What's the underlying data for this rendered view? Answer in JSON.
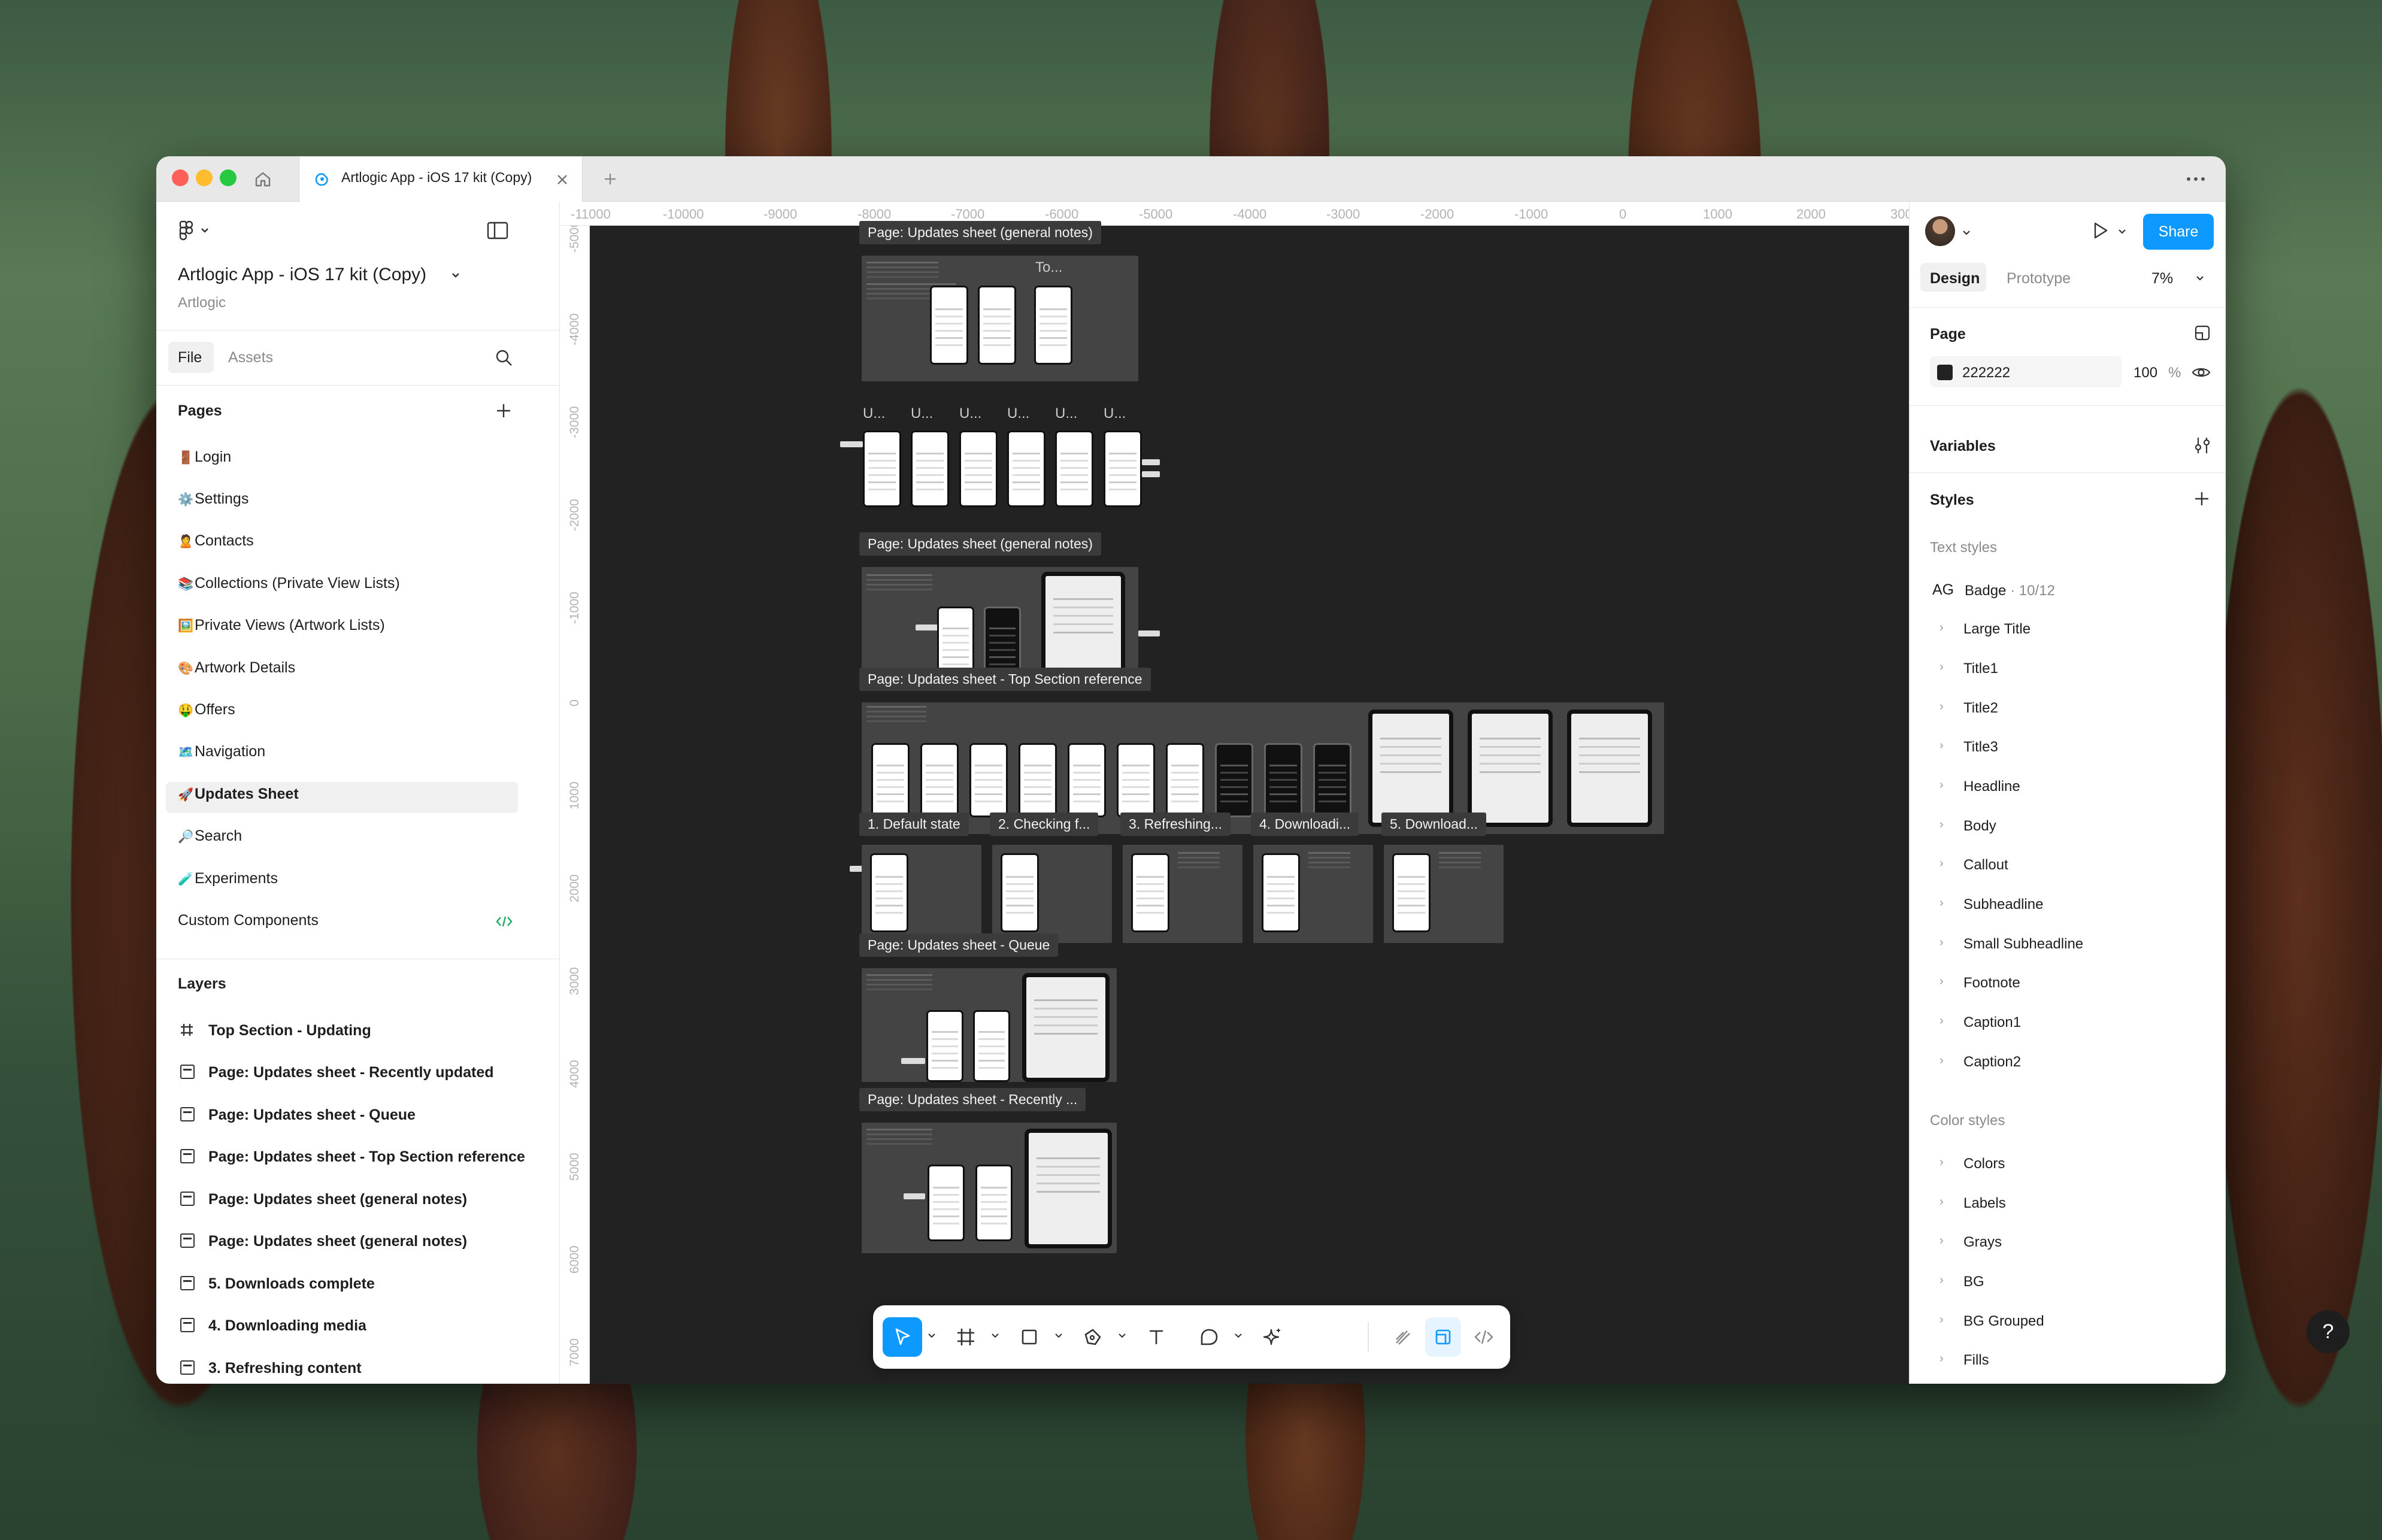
{
  "tab": {
    "title": "Artlogic App - iOS 17 kit (Copy)"
  },
  "file": {
    "name": "Artlogic App - iOS 17 kit (Copy)",
    "team": "Artlogic"
  },
  "left_tabs": {
    "file": "File",
    "assets": "Assets"
  },
  "pages": {
    "heading": "Pages",
    "items": [
      {
        "emoji": "🚪",
        "label": "Login"
      },
      {
        "emoji": "⚙️",
        "label": "Settings"
      },
      {
        "emoji": "🙎",
        "label": "Contacts"
      },
      {
        "emoji": "📚",
        "label": "Collections (Private View Lists)"
      },
      {
        "emoji": "🖼️",
        "label": "Private Views (Artwork Lists)"
      },
      {
        "emoji": "🎨",
        "label": "Artwork Details"
      },
      {
        "emoji": "🤑",
        "label": "Offers"
      },
      {
        "emoji": "🗺️",
        "label": "Navigation"
      },
      {
        "emoji": "🚀",
        "label": "Updates Sheet"
      },
      {
        "emoji": "🔎",
        "label": "Search"
      },
      {
        "emoji": "🧪",
        "label": "Experiments"
      },
      {
        "emoji": "",
        "label": "Custom Components"
      }
    ],
    "selected": "Updates Sheet"
  },
  "layers": {
    "heading": "Layers",
    "items": [
      "Top Section - Updating",
      "Page: Updates sheet - Recently updated",
      "Page: Updates sheet - Queue",
      "Page: Updates sheet - Top Section reference",
      "Page: Updates sheet (general notes)",
      "Page: Updates sheet (general notes)",
      "5. Downloads complete",
      "4. Downloading media",
      "3. Refreshing content"
    ]
  },
  "ruler": {
    "x": [
      "-11000",
      "-10000",
      "-9000",
      "-8000",
      "-7000",
      "-6000",
      "-5000",
      "-4000",
      "-3000",
      "-2000",
      "-1000",
      "0",
      "1000",
      "2000",
      "300"
    ],
    "y": [
      "-5000",
      "-4000",
      "-3000",
      "-2000",
      "-1000",
      "0",
      "1000",
      "2000",
      "3000",
      "4000",
      "5000",
      "6000",
      "7000"
    ]
  },
  "canvas": {
    "labels": {
      "general_notes_1": "Page: Updates sheet (general notes)",
      "todo": "To...",
      "u": [
        "U...",
        "U...",
        "U...",
        "U...",
        "U...",
        "U..."
      ],
      "general_notes_2": "Page: Updates sheet (general notes)",
      "top_section": "Page: Updates sheet - Top Section reference",
      "states": [
        "1. Default state",
        "2. Checking f...",
        "3. Refreshing...",
        "4. Downloadi...",
        "5. Download..."
      ],
      "queue": "Page: Updates sheet - Queue",
      "recently": "Page: Updates sheet - Recently ..."
    },
    "background_hex": "#222222"
  },
  "right": {
    "tabs": {
      "design": "Design",
      "prototype": "Prototype"
    },
    "zoom": "7%",
    "share": "Share",
    "page": {
      "heading": "Page",
      "color": "222222",
      "opacity": "100",
      "unit": "%"
    },
    "variables": "Variables",
    "styles": "Styles",
    "text_styles": {
      "heading": "Text styles",
      "badge": {
        "ag": "AG",
        "name": "Badge",
        "meta": " · 10/12"
      },
      "groups": [
        "Large Title",
        "Title1",
        "Title2",
        "Title3",
        "Headline",
        "Body",
        "Callout",
        "Subheadline",
        "Small Subheadline",
        "Footnote",
        "Caption1",
        "Caption2"
      ]
    },
    "color_styles": {
      "heading": "Color styles",
      "groups": [
        "Colors",
        "Labels",
        "Grays",
        "BG",
        "BG Grouped",
        "Fills"
      ]
    }
  },
  "help": "?",
  "colors": {
    "accent": "#0d99ff",
    "canvas": "#222222",
    "selected_row": "#f0f0f0"
  }
}
